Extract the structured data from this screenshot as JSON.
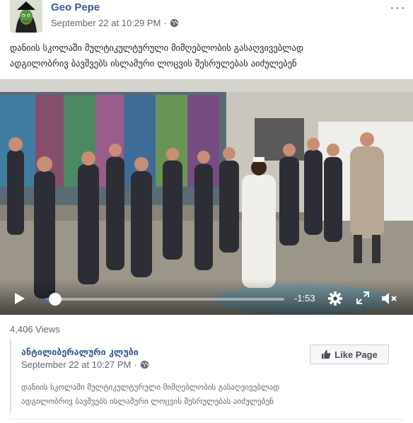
{
  "post": {
    "author": "Geo Pepe",
    "timestamp": "September 22 at 10:29 PM",
    "separator": "·",
    "privacy_icon": "globe-icon",
    "more_icon": "more-options-icon",
    "more_glyph": "···",
    "text_line1": "დანიის სკოლაში მულტიკულტურული მიმღებლობის გასაღვივებლად",
    "text_line2": "ადგილობრივ ბავშვებს ისლამური ლოცვის შესრულებას აიძულებენ"
  },
  "video": {
    "state": "paused",
    "progress_fraction": 0.04,
    "time_remaining": "-1:53",
    "controls": [
      "play-icon",
      "settings-gear-icon",
      "fullscreen-icon",
      "volume-muted-icon"
    ],
    "colors": {
      "seek_played": "#4080ff",
      "controls_fg": "#ffffff"
    }
  },
  "stats": {
    "views": "4,406 Views"
  },
  "shared": {
    "page_name": "ანტილიბერალური კლუბი",
    "timestamp": "September 22 at 10:27 PM",
    "separator": "·",
    "privacy_icon": "globe-icon",
    "like_button": "Like Page",
    "like_icon": "thumbs-up-icon",
    "text_line1": "დანიის სკოლაში მულტიკულტურული მიმღებლობის გასაღვივებლად",
    "text_line2": "ადგილობრივ ბავშვებს ისლამური ლოცვის შესრულებას აიძულებენ"
  },
  "theme": {
    "link": "#385898",
    "meta": "#606770",
    "text": "#1c1e21"
  }
}
